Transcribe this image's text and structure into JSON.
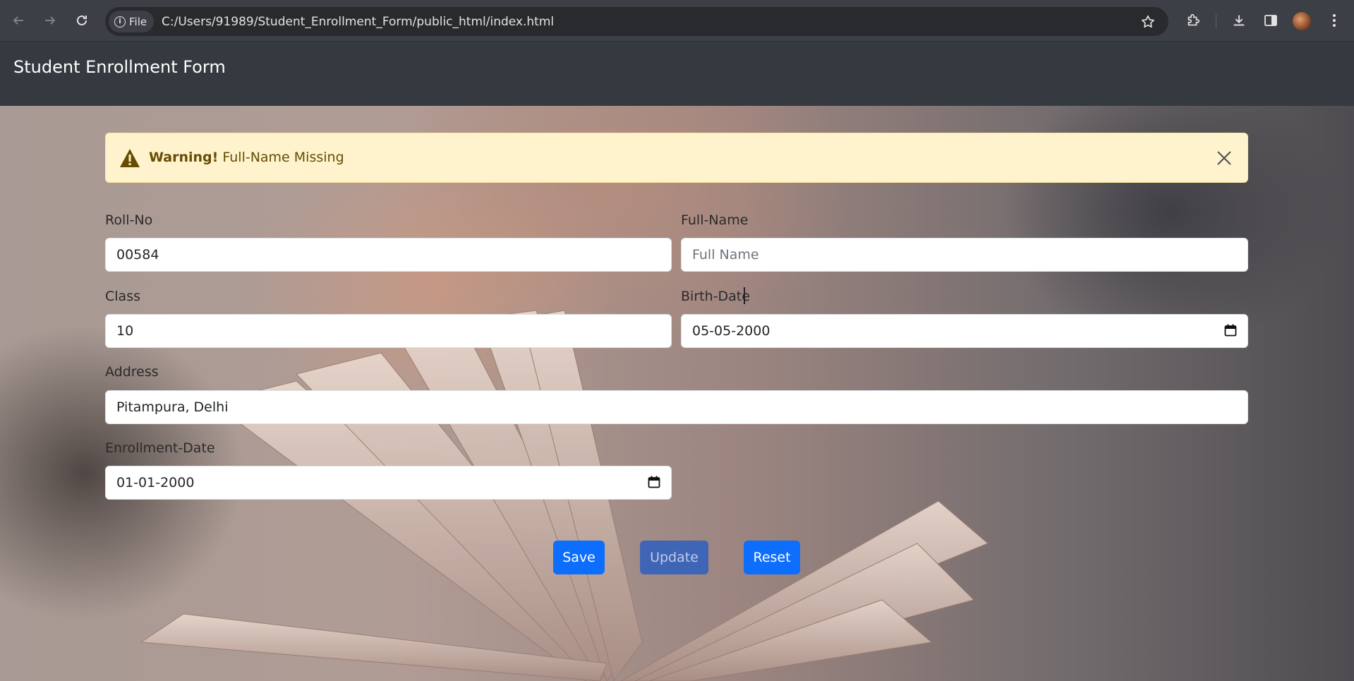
{
  "browser": {
    "back_icon": "back-arrow-icon",
    "forward_icon": "forward-arrow-icon",
    "reload_icon": "reload-icon",
    "chip_label": "File",
    "url": "C:/Users/91989/Student_Enrollment_Form/public_html/index.html"
  },
  "navbar": {
    "brand": "Student Enrollment Form",
    "background": "#343a40"
  },
  "alert": {
    "strong": "Warning!",
    "message": " Full-Name Missing",
    "background": "#fff3cd",
    "text_color": "#664d03"
  },
  "form": {
    "roll_no": {
      "label": "Roll-No",
      "value": "00584",
      "placeholder": ""
    },
    "full_name": {
      "label": "Full-Name",
      "value": "",
      "placeholder": "Full Name"
    },
    "class": {
      "label": "Class",
      "value": "10",
      "placeholder": ""
    },
    "birth_date": {
      "label": "Birth-Date",
      "value": "05-05-2000"
    },
    "address": {
      "label": "Address",
      "value": "Pitampura, Delhi",
      "placeholder": ""
    },
    "enrollment_date": {
      "label": "Enrollment-Date",
      "value": "01-01-2000"
    }
  },
  "buttons": {
    "save": "Save",
    "update": "Update",
    "reset": "Reset",
    "primary_color": "#0d6efd"
  }
}
